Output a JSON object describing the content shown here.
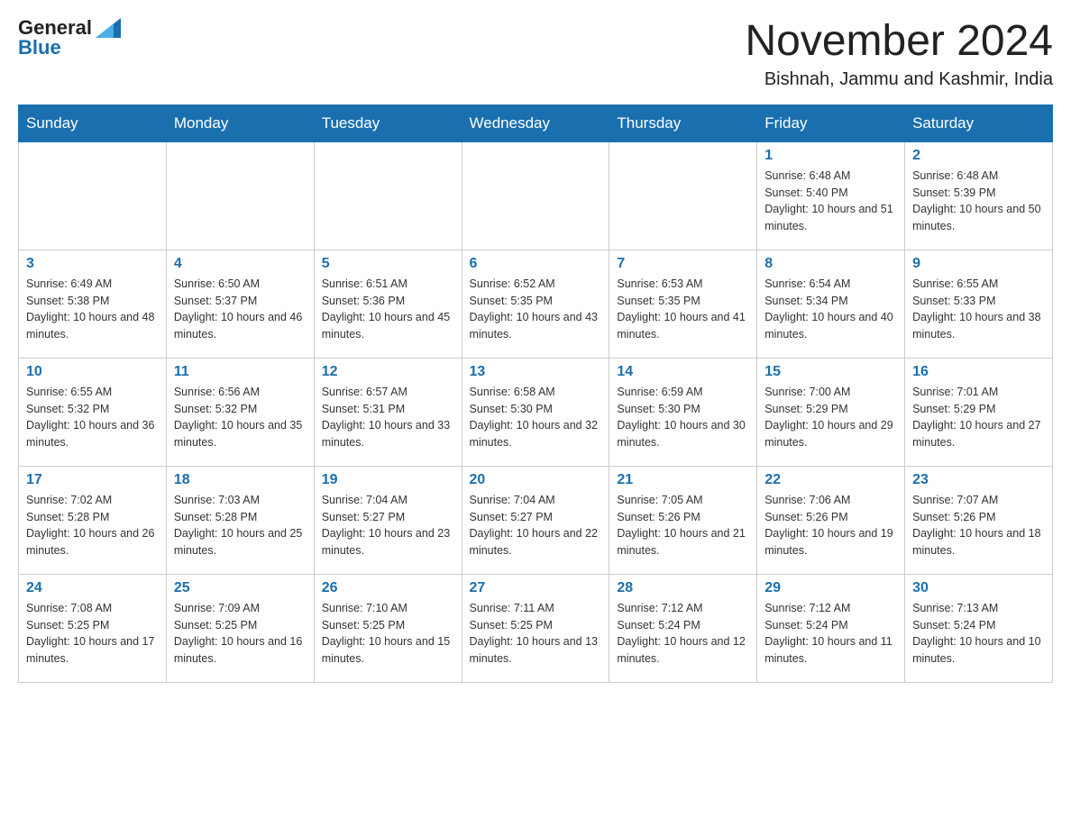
{
  "header": {
    "logo": {
      "general": "General",
      "blue": "Blue"
    },
    "title": "November 2024",
    "location": "Bishnah, Jammu and Kashmir, India"
  },
  "weekdays": [
    "Sunday",
    "Monday",
    "Tuesday",
    "Wednesday",
    "Thursday",
    "Friday",
    "Saturday"
  ],
  "weeks": [
    [
      {
        "day": null,
        "sunrise": null,
        "sunset": null,
        "daylight": null
      },
      {
        "day": null,
        "sunrise": null,
        "sunset": null,
        "daylight": null
      },
      {
        "day": null,
        "sunrise": null,
        "sunset": null,
        "daylight": null
      },
      {
        "day": null,
        "sunrise": null,
        "sunset": null,
        "daylight": null
      },
      {
        "day": null,
        "sunrise": null,
        "sunset": null,
        "daylight": null
      },
      {
        "day": "1",
        "sunrise": "Sunrise: 6:48 AM",
        "sunset": "Sunset: 5:40 PM",
        "daylight": "Daylight: 10 hours and 51 minutes."
      },
      {
        "day": "2",
        "sunrise": "Sunrise: 6:48 AM",
        "sunset": "Sunset: 5:39 PM",
        "daylight": "Daylight: 10 hours and 50 minutes."
      }
    ],
    [
      {
        "day": "3",
        "sunrise": "Sunrise: 6:49 AM",
        "sunset": "Sunset: 5:38 PM",
        "daylight": "Daylight: 10 hours and 48 minutes."
      },
      {
        "day": "4",
        "sunrise": "Sunrise: 6:50 AM",
        "sunset": "Sunset: 5:37 PM",
        "daylight": "Daylight: 10 hours and 46 minutes."
      },
      {
        "day": "5",
        "sunrise": "Sunrise: 6:51 AM",
        "sunset": "Sunset: 5:36 PM",
        "daylight": "Daylight: 10 hours and 45 minutes."
      },
      {
        "day": "6",
        "sunrise": "Sunrise: 6:52 AM",
        "sunset": "Sunset: 5:35 PM",
        "daylight": "Daylight: 10 hours and 43 minutes."
      },
      {
        "day": "7",
        "sunrise": "Sunrise: 6:53 AM",
        "sunset": "Sunset: 5:35 PM",
        "daylight": "Daylight: 10 hours and 41 minutes."
      },
      {
        "day": "8",
        "sunrise": "Sunrise: 6:54 AM",
        "sunset": "Sunset: 5:34 PM",
        "daylight": "Daylight: 10 hours and 40 minutes."
      },
      {
        "day": "9",
        "sunrise": "Sunrise: 6:55 AM",
        "sunset": "Sunset: 5:33 PM",
        "daylight": "Daylight: 10 hours and 38 minutes."
      }
    ],
    [
      {
        "day": "10",
        "sunrise": "Sunrise: 6:55 AM",
        "sunset": "Sunset: 5:32 PM",
        "daylight": "Daylight: 10 hours and 36 minutes."
      },
      {
        "day": "11",
        "sunrise": "Sunrise: 6:56 AM",
        "sunset": "Sunset: 5:32 PM",
        "daylight": "Daylight: 10 hours and 35 minutes."
      },
      {
        "day": "12",
        "sunrise": "Sunrise: 6:57 AM",
        "sunset": "Sunset: 5:31 PM",
        "daylight": "Daylight: 10 hours and 33 minutes."
      },
      {
        "day": "13",
        "sunrise": "Sunrise: 6:58 AM",
        "sunset": "Sunset: 5:30 PM",
        "daylight": "Daylight: 10 hours and 32 minutes."
      },
      {
        "day": "14",
        "sunrise": "Sunrise: 6:59 AM",
        "sunset": "Sunset: 5:30 PM",
        "daylight": "Daylight: 10 hours and 30 minutes."
      },
      {
        "day": "15",
        "sunrise": "Sunrise: 7:00 AM",
        "sunset": "Sunset: 5:29 PM",
        "daylight": "Daylight: 10 hours and 29 minutes."
      },
      {
        "day": "16",
        "sunrise": "Sunrise: 7:01 AM",
        "sunset": "Sunset: 5:29 PM",
        "daylight": "Daylight: 10 hours and 27 minutes."
      }
    ],
    [
      {
        "day": "17",
        "sunrise": "Sunrise: 7:02 AM",
        "sunset": "Sunset: 5:28 PM",
        "daylight": "Daylight: 10 hours and 26 minutes."
      },
      {
        "day": "18",
        "sunrise": "Sunrise: 7:03 AM",
        "sunset": "Sunset: 5:28 PM",
        "daylight": "Daylight: 10 hours and 25 minutes."
      },
      {
        "day": "19",
        "sunrise": "Sunrise: 7:04 AM",
        "sunset": "Sunset: 5:27 PM",
        "daylight": "Daylight: 10 hours and 23 minutes."
      },
      {
        "day": "20",
        "sunrise": "Sunrise: 7:04 AM",
        "sunset": "Sunset: 5:27 PM",
        "daylight": "Daylight: 10 hours and 22 minutes."
      },
      {
        "day": "21",
        "sunrise": "Sunrise: 7:05 AM",
        "sunset": "Sunset: 5:26 PM",
        "daylight": "Daylight: 10 hours and 21 minutes."
      },
      {
        "day": "22",
        "sunrise": "Sunrise: 7:06 AM",
        "sunset": "Sunset: 5:26 PM",
        "daylight": "Daylight: 10 hours and 19 minutes."
      },
      {
        "day": "23",
        "sunrise": "Sunrise: 7:07 AM",
        "sunset": "Sunset: 5:26 PM",
        "daylight": "Daylight: 10 hours and 18 minutes."
      }
    ],
    [
      {
        "day": "24",
        "sunrise": "Sunrise: 7:08 AM",
        "sunset": "Sunset: 5:25 PM",
        "daylight": "Daylight: 10 hours and 17 minutes."
      },
      {
        "day": "25",
        "sunrise": "Sunrise: 7:09 AM",
        "sunset": "Sunset: 5:25 PM",
        "daylight": "Daylight: 10 hours and 16 minutes."
      },
      {
        "day": "26",
        "sunrise": "Sunrise: 7:10 AM",
        "sunset": "Sunset: 5:25 PM",
        "daylight": "Daylight: 10 hours and 15 minutes."
      },
      {
        "day": "27",
        "sunrise": "Sunrise: 7:11 AM",
        "sunset": "Sunset: 5:25 PM",
        "daylight": "Daylight: 10 hours and 13 minutes."
      },
      {
        "day": "28",
        "sunrise": "Sunrise: 7:12 AM",
        "sunset": "Sunset: 5:24 PM",
        "daylight": "Daylight: 10 hours and 12 minutes."
      },
      {
        "day": "29",
        "sunrise": "Sunrise: 7:12 AM",
        "sunset": "Sunset: 5:24 PM",
        "daylight": "Daylight: 10 hours and 11 minutes."
      },
      {
        "day": "30",
        "sunrise": "Sunrise: 7:13 AM",
        "sunset": "Sunset: 5:24 PM",
        "daylight": "Daylight: 10 hours and 10 minutes."
      }
    ]
  ]
}
